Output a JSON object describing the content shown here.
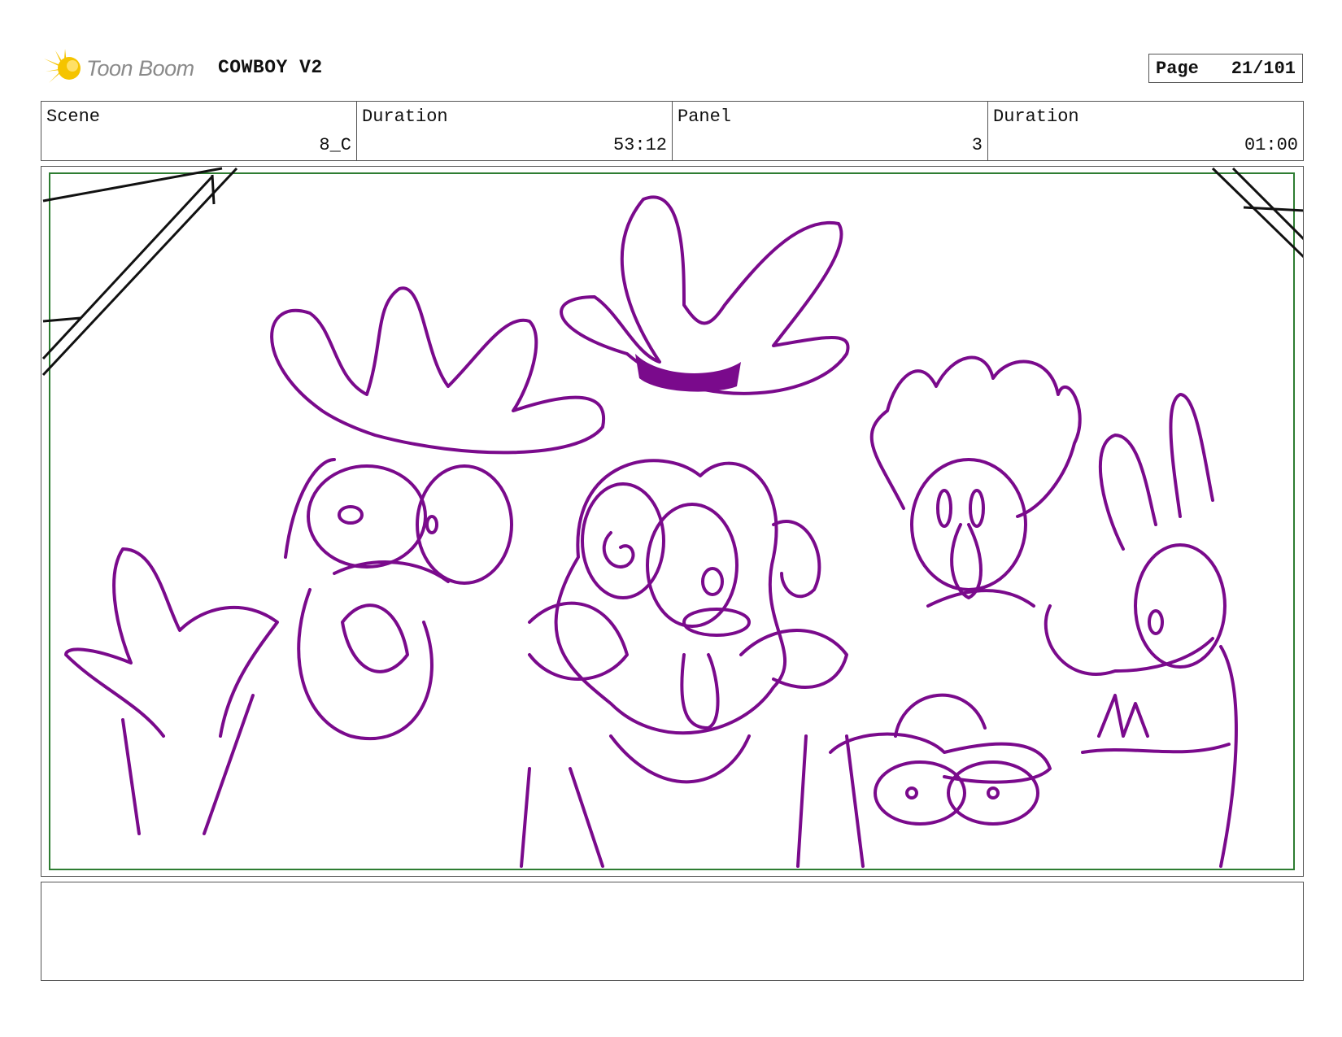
{
  "header": {
    "logo_text": "Toon Boom",
    "project_title": "COWBOY V2",
    "page_label": "Page",
    "page_number": "21/101"
  },
  "info": [
    {
      "label": "Scene",
      "value": "8_C"
    },
    {
      "label": "Duration",
      "value": "53:12"
    },
    {
      "label": "Panel",
      "value": "3"
    },
    {
      "label": "Duration",
      "value": "01:00"
    }
  ],
  "panel": {
    "image_icon": "storyboard-sketch",
    "line_color": "#7a0a8c",
    "safe_frame_color": "#2e7d32"
  },
  "notes": {
    "text": ""
  }
}
